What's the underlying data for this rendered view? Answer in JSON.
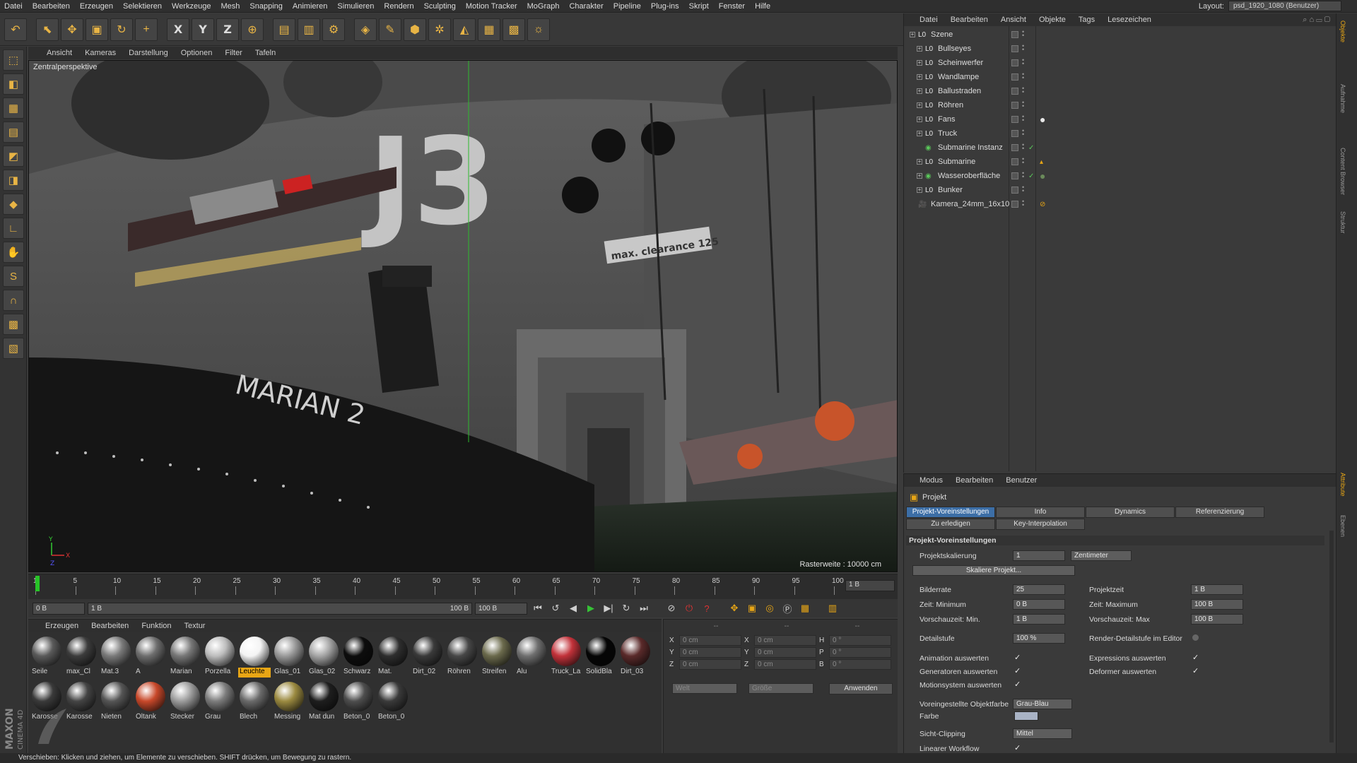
{
  "menubar": {
    "items": [
      "Datei",
      "Bearbeiten",
      "Erzeugen",
      "Selektieren",
      "Werkzeuge",
      "Mesh",
      "Snapping",
      "Animieren",
      "Simulieren",
      "Rendern",
      "Sculpting",
      "Motion Tracker",
      "MoGraph",
      "Charakter",
      "Pipeline",
      "Plug-ins",
      "Skript",
      "Fenster",
      "Hilfe"
    ],
    "layout_label": "Layout:",
    "layout_value": "psd_1920_1080 (Benutzer)"
  },
  "toolbar": {
    "icons": [
      "undo-icon",
      "live-select-icon",
      "move-icon",
      "scale-icon",
      "rotate-icon",
      "add-icon",
      "x-axis-icon",
      "y-axis-icon",
      "z-axis-icon",
      "world-coords-icon",
      "render-view-icon",
      "render-picture-queue-icon",
      "render-settings-icon",
      "cube-icon",
      "pen-icon",
      "subdivision-icon",
      "cloner-icon",
      "deformer-icon",
      "floor-icon",
      "camera-icon",
      "light-icon"
    ],
    "axis_x": "X",
    "axis_y": "Y",
    "axis_z": "Z"
  },
  "viewport": {
    "menu": [
      "Ansicht",
      "Kameras",
      "Darstellung",
      "Optionen",
      "Filter",
      "Tafeln"
    ],
    "label": "Zentralperspektive",
    "raster": "Rasterweite : 10000 cm",
    "scene_text_1": "J3",
    "scene_text_2": "MARIAN 2",
    "scene_text_3": "max. clearance 125"
  },
  "timeline": {
    "ticks": [
      "1",
      "5",
      "10",
      "15",
      "20",
      "25",
      "30",
      "35",
      "40",
      "45",
      "50",
      "55",
      "60",
      "65",
      "70",
      "75",
      "80",
      "85",
      "90",
      "95",
      "100"
    ],
    "end_field": "1 B"
  },
  "transport": {
    "current": "0 B",
    "range_start": "1 B",
    "range_end": "100 B",
    "max": "100 B"
  },
  "materials": {
    "menu": [
      "Erzeugen",
      "Bearbeiten",
      "Funktion",
      "Textur"
    ],
    "items": [
      {
        "label": "Seile",
        "color": "#5a5a5a"
      },
      {
        "label": "max_Cl",
        "color": "#3c3c3c"
      },
      {
        "label": "Mat.3",
        "color": "#7a7a7a"
      },
      {
        "label": "A",
        "color": "#6e6e6e"
      },
      {
        "label": "Marian",
        "color": "#777777"
      },
      {
        "label": "Porzella",
        "color": "#bdbdbd"
      },
      {
        "label": "Leuchte",
        "color": "#f4f4f4",
        "selected": true
      },
      {
        "label": "Glas_01",
        "color": "#9a9a9a"
      },
      {
        "label": "Glas_02",
        "color": "#a5a5a5"
      },
      {
        "label": "Schwarz",
        "color": "#0d0d0d"
      },
      {
        "label": "Mat.",
        "color": "#2e2e2e"
      },
      {
        "label": "Dirt_02",
        "color": "#3a3a3a"
      },
      {
        "label": "Röhren",
        "color": "#474747"
      },
      {
        "label": "Streifen",
        "color": "#6b6a4c"
      },
      {
        "label": "Alu",
        "color": "#6f6f6f"
      },
      {
        "label": "Truck_La",
        "color": "#c2323a"
      },
      {
        "label": "SolidBla",
        "color": "#050505"
      },
      {
        "label": "Dirt_03",
        "color": "#5a2a2a"
      },
      {
        "label": "Karosse",
        "color": "#3a3a3a"
      },
      {
        "label": "Karosse",
        "color": "#444444"
      },
      {
        "label": "Nieten",
        "color": "#555555"
      },
      {
        "label": "Öltank",
        "color": "#c8482a"
      },
      {
        "label": "Stecker",
        "color": "#9c9c9c"
      },
      {
        "label": "Grau",
        "color": "#7c7c7c"
      },
      {
        "label": "Blech",
        "color": "#6a6a6a"
      },
      {
        "label": "Messing",
        "color": "#9b8a40"
      },
      {
        "label": "Mat dun",
        "color": "#1e1e1e"
      },
      {
        "label": "Beton_0",
        "color": "#4e4e4e"
      },
      {
        "label": "Beton_0",
        "color": "#3a3a3a"
      }
    ]
  },
  "coords": {
    "header": [
      "--",
      "--",
      "--"
    ],
    "rows": [
      {
        "a": "X",
        "av": "0 cm",
        "b": "X",
        "bv": "0 cm",
        "c": "H",
        "cv": "0 °"
      },
      {
        "a": "Y",
        "av": "0 cm",
        "b": "Y",
        "bv": "0 cm",
        "c": "P",
        "cv": "0 °"
      },
      {
        "a": "Z",
        "av": "0 cm",
        "b": "Z",
        "bv": "0 cm",
        "c": "B",
        "cv": "0 °"
      }
    ],
    "mode1": "Welt",
    "mode2": "Größe",
    "apply": "Anwenden"
  },
  "objects": {
    "menu": [
      "Datei",
      "Bearbeiten",
      "Ansicht",
      "Objekte",
      "Tags",
      "Lesezeichen"
    ],
    "items": [
      {
        "name": "Szene",
        "level": 0,
        "icon": "L0"
      },
      {
        "name": "Bullseyes",
        "level": 1,
        "icon": "L0"
      },
      {
        "name": "Scheinwerfer",
        "level": 1,
        "icon": "L0"
      },
      {
        "name": "Wandlampe",
        "level": 1,
        "icon": "L0"
      },
      {
        "name": "Ballustraden",
        "level": 1,
        "icon": "L0"
      },
      {
        "name": "Röhren",
        "level": 1,
        "icon": "L0"
      },
      {
        "name": "Fans",
        "level": 1,
        "icon": "L0"
      },
      {
        "name": "Truck",
        "level": 1,
        "icon": "L0"
      },
      {
        "name": "Submarine Instanz",
        "level": 1,
        "icon": "inst"
      },
      {
        "name": "Submarine",
        "level": 1,
        "icon": "L0"
      },
      {
        "name": "Wasseroberfläche",
        "level": 1,
        "icon": "plane"
      },
      {
        "name": "Bunker",
        "level": 1,
        "icon": "L0"
      },
      {
        "name": "Kamera_24mm_16x10",
        "level": 0,
        "icon": "cam"
      }
    ]
  },
  "attributes": {
    "menu": [
      "Modus",
      "Bearbeiten",
      "Benutzer"
    ],
    "title": "Projekt",
    "tabs": [
      "Projekt-Voreinstellungen",
      "Info",
      "Dynamics",
      "Referenzierung",
      "Zu erledigen",
      "Key-Interpolation"
    ],
    "section": "Projekt-Voreinstellungen",
    "projektskalierung_label": "Projektskalierung",
    "projektskalierung_value": "1",
    "projektskalierung_unit": "Zentimeter",
    "skaliere": "Skaliere Projekt...",
    "bildrate_label": "Bilderrate",
    "bildrate_value": "25",
    "projektzeit_label": "Projektzeit",
    "projektzeit_value": "1 B",
    "zeitmin_label": "Zeit: Minimum",
    "zeitmin_value": "0 B",
    "zeitmax_label": "Zeit: Maximum",
    "zeitmax_value": "100 B",
    "vorschaumin_label": "Vorschauzeit: Min.",
    "vorschaumin_value": "1 B",
    "vorschaumax_label": "Vorschauzeit: Max",
    "vorschaumax_value": "100 B",
    "detail_label": "Detailstufe",
    "detail_value": "100 %",
    "renderdetail_label": "Render-Detailstufe im Editor",
    "anim_label": "Animation auswerten",
    "expr_label": "Expressions auswerten",
    "gen_label": "Generatoren auswerten",
    "deform_label": "Deformer auswerten",
    "motion_label": "Motionsystem auswerten",
    "objfarbe_label": "Voreingestellte Objektfarbe",
    "objfarbe_value": "Grau-Blau",
    "farbe_label": "Farbe",
    "farbe_color": "#a9b3c5",
    "clip_label": "Sicht-Clipping",
    "clip_value": "Mittel",
    "linear_label": "Linearer Workflow"
  },
  "right_tabs": [
    "Objekte",
    "Aufnahme",
    "Content Browser",
    "Struktur",
    "Attribute",
    "Ebenen"
  ],
  "status": "Verschieben: Klicken und ziehen, um Elemente zu verschieben. SHIFT drücken, um Bewegung zu rastern.",
  "brand": "MAXON CINEMA 4D"
}
